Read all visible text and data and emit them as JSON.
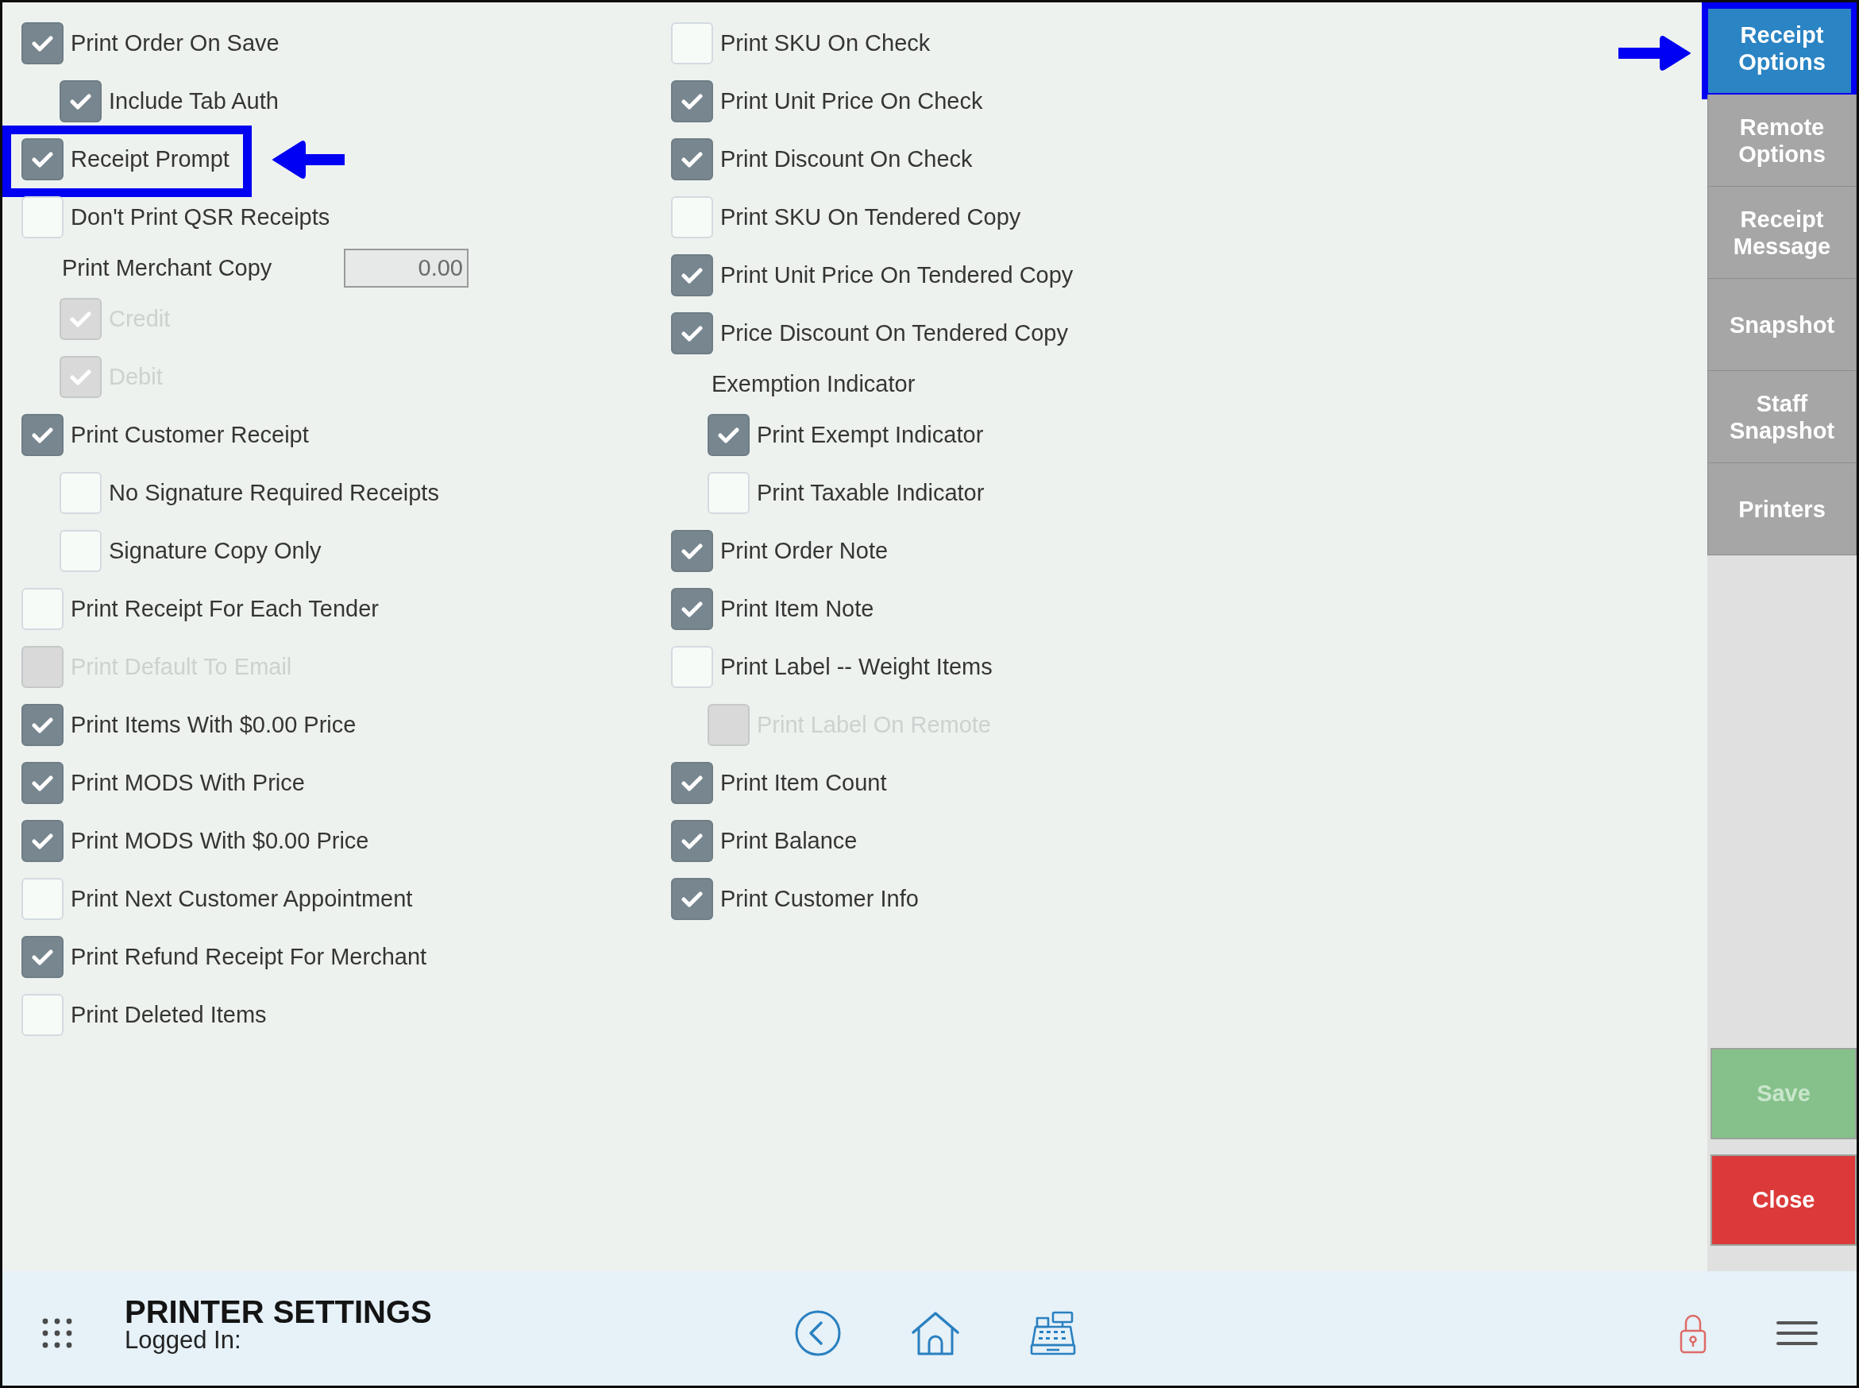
{
  "left_column": [
    {
      "kind": "checkbox",
      "label": "Print Order On Save",
      "checked": true,
      "disabled": false,
      "highlighted": false,
      "children": [
        {
          "kind": "checkbox",
          "label": "Include Tab Auth",
          "checked": true,
          "disabled": false,
          "highlighted": false
        }
      ]
    },
    {
      "kind": "checkbox",
      "label": "Receipt Prompt",
      "checked": true,
      "disabled": false,
      "highlighted": true
    },
    {
      "kind": "checkbox",
      "label": "Don't Print QSR Receipts",
      "checked": false,
      "disabled": false,
      "highlighted": false
    },
    {
      "kind": "number_field",
      "label": "Print Merchant Copy",
      "value": "0.00",
      "highlighted": false,
      "children": [
        {
          "kind": "checkbox",
          "label": "Credit",
          "checked": true,
          "disabled": true,
          "highlighted": false
        },
        {
          "kind": "checkbox",
          "label": "Debit",
          "checked": true,
          "disabled": true,
          "highlighted": false
        }
      ]
    },
    {
      "kind": "checkbox",
      "label": "Print Customer Receipt",
      "checked": true,
      "disabled": false,
      "highlighted": false,
      "children": [
        {
          "kind": "checkbox",
          "label": "No Signature Required Receipts",
          "checked": false,
          "disabled": false,
          "highlighted": false
        },
        {
          "kind": "checkbox",
          "label": "Signature Copy Only",
          "checked": false,
          "disabled": false,
          "highlighted": false
        }
      ]
    },
    {
      "kind": "checkbox",
      "label": "Print Receipt For Each Tender",
      "checked": false,
      "disabled": false,
      "highlighted": false
    },
    {
      "kind": "checkbox",
      "label": "Print Default To Email",
      "checked": false,
      "disabled": true,
      "highlighted": false
    },
    {
      "kind": "checkbox",
      "label": "Print Items With $0.00 Price",
      "checked": true,
      "disabled": false,
      "highlighted": false
    },
    {
      "kind": "checkbox",
      "label": "Print MODS With Price",
      "checked": true,
      "disabled": false,
      "highlighted": false
    },
    {
      "kind": "checkbox",
      "label": "Print MODS With $0.00 Price",
      "checked": true,
      "disabled": false,
      "highlighted": false
    },
    {
      "kind": "checkbox",
      "label": "Print Next Customer Appointment",
      "checked": false,
      "disabled": false,
      "highlighted": false
    },
    {
      "kind": "checkbox",
      "label": "Print Refund Receipt For Merchant",
      "checked": true,
      "disabled": false,
      "highlighted": false
    },
    {
      "kind": "checkbox",
      "label": "Print Deleted Items",
      "checked": false,
      "disabled": false,
      "highlighted": false
    }
  ],
  "middle_column": [
    {
      "kind": "checkbox",
      "label": "Print SKU On Check",
      "checked": false,
      "disabled": false,
      "highlighted": false
    },
    {
      "kind": "checkbox",
      "label": "Print Unit Price On Check",
      "checked": true,
      "disabled": false,
      "highlighted": false
    },
    {
      "kind": "checkbox",
      "label": "Print Discount On Check",
      "checked": true,
      "disabled": false,
      "highlighted": false
    },
    {
      "kind": "checkbox",
      "label": "Print SKU On Tendered Copy",
      "checked": false,
      "disabled": false,
      "highlighted": false
    },
    {
      "kind": "checkbox",
      "label": "Print Unit Price On Tendered Copy",
      "checked": true,
      "disabled": false,
      "highlighted": false
    },
    {
      "kind": "checkbox",
      "label": "Price Discount On Tendered Copy",
      "checked": true,
      "disabled": false,
      "highlighted": false
    },
    {
      "kind": "heading",
      "label": "Exemption Indicator",
      "highlighted": false,
      "children": [
        {
          "kind": "checkbox",
          "label": "Print Exempt Indicator",
          "checked": true,
          "disabled": false,
          "highlighted": false
        },
        {
          "kind": "checkbox",
          "label": "Print Taxable Indicator",
          "checked": false,
          "disabled": false,
          "highlighted": false
        }
      ]
    },
    {
      "kind": "checkbox",
      "label": "Print Order Note",
      "checked": true,
      "disabled": false,
      "highlighted": false
    },
    {
      "kind": "checkbox",
      "label": "Print Item Note",
      "checked": true,
      "disabled": false,
      "highlighted": false
    },
    {
      "kind": "checkbox",
      "label": "Print Label -- Weight Items",
      "checked": false,
      "disabled": false,
      "highlighted": false,
      "children": [
        {
          "kind": "checkbox",
          "label": "Print Label On Remote",
          "checked": false,
          "disabled": true,
          "highlighted": false
        }
      ]
    },
    {
      "kind": "checkbox",
      "label": "Print Item Count",
      "checked": true,
      "disabled": false,
      "highlighted": false
    },
    {
      "kind": "checkbox",
      "label": "Print Balance",
      "checked": true,
      "disabled": false,
      "highlighted": false
    },
    {
      "kind": "checkbox",
      "label": "Print Customer Info",
      "checked": true,
      "disabled": false,
      "highlighted": false
    }
  ],
  "sidebar": {
    "tabs": [
      {
        "label": "Receipt Options",
        "selected": true,
        "highlighted": true
      },
      {
        "label": "Remote Options",
        "selected": false,
        "highlighted": false
      },
      {
        "label": "Receipt Message",
        "selected": false,
        "highlighted": false
      },
      {
        "label": "Snapshot",
        "selected": false,
        "highlighted": false
      },
      {
        "label": "Staff Snapshot",
        "selected": false,
        "highlighted": false
      },
      {
        "label": "Printers",
        "selected": false,
        "highlighted": false
      }
    ],
    "buttons": [
      {
        "kind": "save",
        "label": "Save",
        "disabled": true
      },
      {
        "kind": "close",
        "label": "Close",
        "disabled": false
      }
    ]
  },
  "footer": {
    "title": "PRINTER SETTINGS",
    "subtitle": "Logged In:"
  }
}
